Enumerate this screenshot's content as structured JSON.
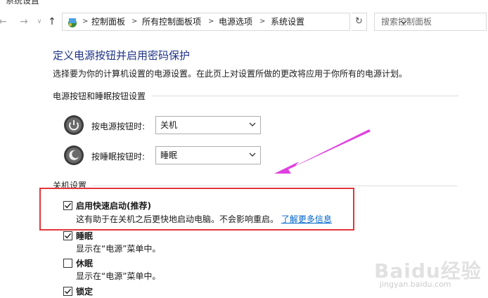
{
  "window": {
    "title": "系统设置"
  },
  "address_bar": {
    "breadcrumbs": [
      "控制面板",
      "所有控制面板项",
      "电源选项",
      "系统设置"
    ],
    "refresh_icon": "refresh-icon"
  },
  "search": {
    "placeholder": "搜索控制面板"
  },
  "page": {
    "title": "定义电源按钮并启用密码保护",
    "description": "选择要为你的计算机设置的电源设置。在此页上对设置所做的更改将应用于你所有的电源计划。"
  },
  "power_section": {
    "heading": "电源按钮和睡眠按钮设置",
    "power_button": {
      "label": "按电源按钮时:",
      "value": "关机"
    },
    "sleep_button": {
      "label": "按睡眠按钮时:",
      "value": "睡眠"
    }
  },
  "shutdown_section": {
    "heading": "关机设置",
    "options": [
      {
        "label": "启用快速启动(推荐)",
        "description": "这有助于在关机之后更快地启动电脑。不会影响重启。",
        "link": "了解更多信息",
        "checked": true
      },
      {
        "label": "睡眠",
        "description": "显示在“电源”菜单中。",
        "checked": true
      },
      {
        "label": "休眠",
        "description": "显示在“电源”菜单中。",
        "checked": false
      },
      {
        "label": "锁定",
        "checked": true
      }
    ]
  },
  "annotation": {
    "highlight_color": "#e3363a",
    "arrow_color": "#e040e0"
  },
  "watermark": {
    "brand": "Baidu经验",
    "url": "jingyan.baidu.com"
  }
}
